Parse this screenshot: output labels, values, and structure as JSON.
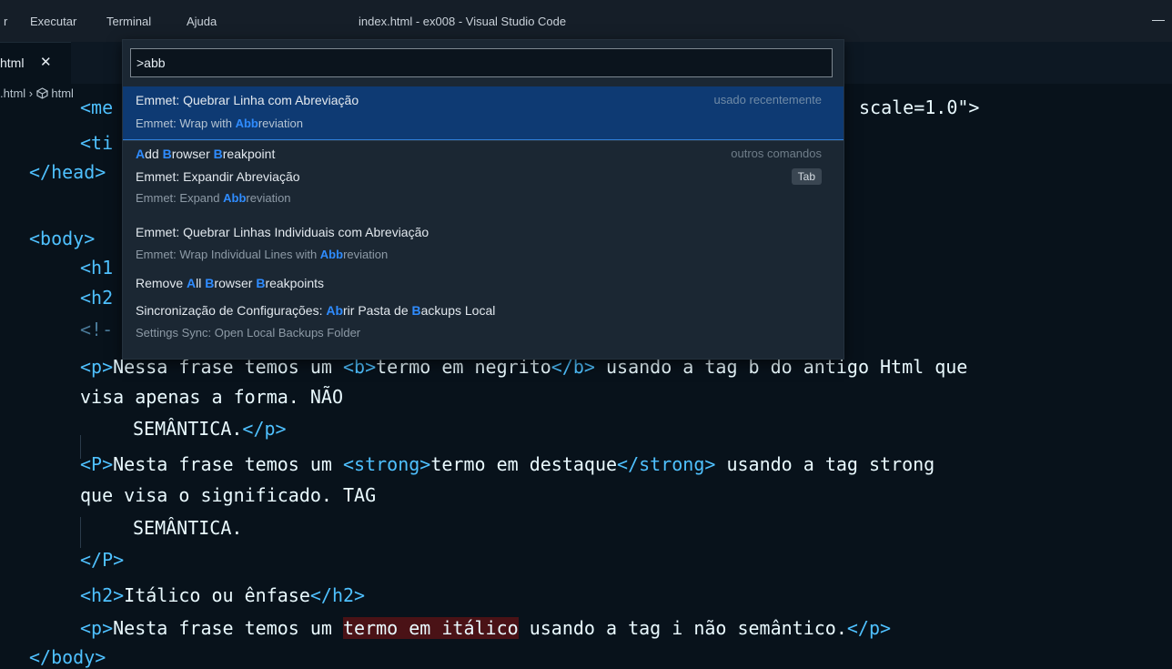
{
  "titlebar": {
    "menu_fragment": "r",
    "menu_executar": "Executar",
    "menu_terminal": "Terminal",
    "menu_ajuda": "Ajuda",
    "window_title": "index.html - ex008 - Visual Studio Code"
  },
  "tab": {
    "label": "html",
    "close": "✕"
  },
  "breadcrumb": {
    "file": ".html",
    "sep": "›",
    "icon": "cube-icon",
    "node": "html"
  },
  "quickpick": {
    "input_value": ">abb",
    "items": [
      {
        "label": "Emmet: Quebrar Linha com Abreviação",
        "detail_pre": "Emmet: Wrap with ",
        "detail_hl": "Abb",
        "detail_post": "reviation",
        "right": "usado recentemente"
      },
      {
        "label_parts": [
          "A",
          "dd ",
          "B",
          "rowser ",
          "B",
          "reakpoint"
        ],
        "right": "outros comandos"
      },
      {
        "label": "Emmet: Expandir Abreviação",
        "detail_pre": "Emmet: Expand ",
        "detail_hl": "Abb",
        "detail_post": "reviation",
        "kbd": "Tab"
      },
      {
        "label": "Emmet: Quebrar Linhas Individuais com Abreviação",
        "detail_pre": "Emmet: Wrap Individual Lines with ",
        "detail_hl": "Abb",
        "detail_post": "reviation"
      },
      {
        "label_parts": [
          "Remove ",
          "A",
          "ll ",
          "B",
          "rowser ",
          "B",
          "reakpoints"
        ]
      },
      {
        "label_parts": [
          "Sincronização de Configurações: ",
          "Ab",
          "rir Pasta de ",
          "B",
          "ackups Local"
        ],
        "detail": "Settings Sync: Open Local Backups Folder"
      }
    ]
  },
  "code": {
    "l0_a": "<me",
    "l0_b": "scale=1.0\">",
    "l1": "<ti",
    "l2": "</head>",
    "l3": "<body>",
    "l4": "<h1",
    "l5": "<h2",
    "l6": "<!-",
    "l7_a": "<p>",
    "l7_b": "Nessa frase temos um ",
    "l7_c": "<b>",
    "l7_d": "termo em negrito",
    "l7_e": "</b>",
    "l7_f": " usando a tag b do antigo Html que",
    "l8": "visa apenas a forma. NÃO",
    "l9_a": "SEMÂNTICA.",
    "l9_b": "</p>",
    "l10_a": "<P>",
    "l10_b": "Nesta frase temos um ",
    "l10_c": "<strong>",
    "l10_d": "termo em destaque",
    "l10_e": "</strong>",
    "l10_f": " usando a tag strong",
    "l11": "que visa o significado. TAG",
    "l12": "SEMÂNTICA.",
    "l13": "</P>",
    "l14_a": "<h2>",
    "l14_b": "Itálico ou ênfase",
    "l14_c": "</h2>",
    "l15_a": "<p>",
    "l15_b": "Nesta frase temos um ",
    "l15_c": "termo em itálico",
    "l15_d": " usando a tag i não semântico.",
    "l15_e": "</p>",
    "l16": "</body>"
  }
}
